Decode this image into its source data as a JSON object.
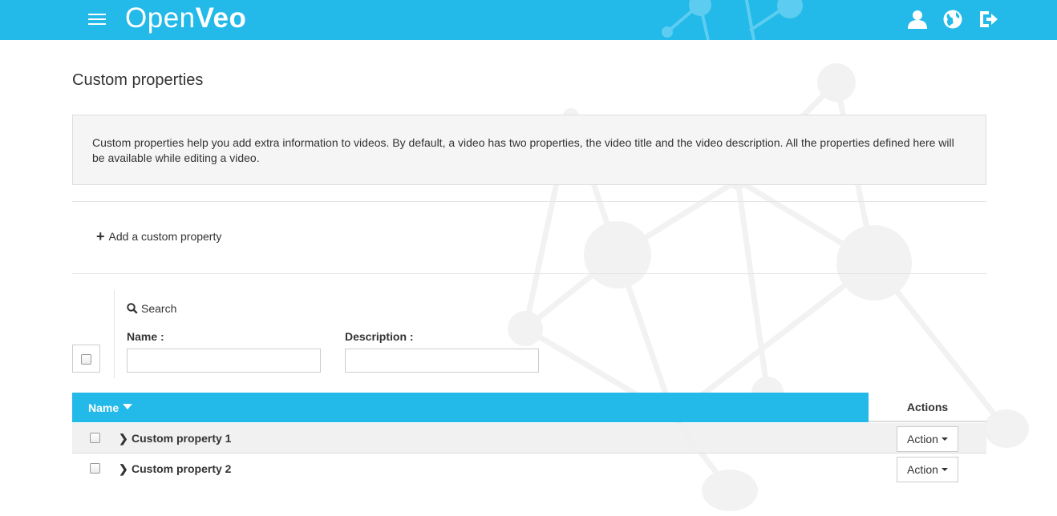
{
  "header": {
    "logo_light": "Open",
    "logo_bold": "Veo",
    "icons": [
      "user-icon",
      "globe-icon",
      "logout-icon"
    ],
    "bg_color": "#23b9e9"
  },
  "page": {
    "title": "Custom properties",
    "info": "Custom properties help you add extra information to videos. By default, a video has two properties, the video title and the video description. All the properties defined here will be available while editing a video.",
    "add_label": "Add a custom property"
  },
  "search": {
    "label": "Search",
    "name_label": "Name :",
    "name_value": "",
    "description_label": "Description :",
    "description_value": ""
  },
  "table": {
    "name_header": "Name",
    "actions_header": "Actions",
    "rows": [
      {
        "name": "Custom property 1",
        "action_label": "Action"
      },
      {
        "name": "Custom property 2",
        "action_label": "Action"
      }
    ]
  }
}
